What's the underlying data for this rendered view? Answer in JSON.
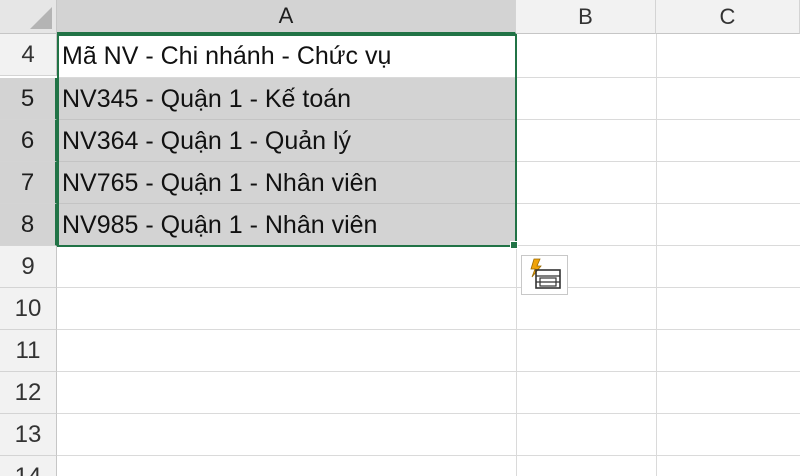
{
  "columns": [
    "A",
    "B",
    "C"
  ],
  "rows": [
    "4",
    "5",
    "6",
    "7",
    "8",
    "9",
    "10",
    "11",
    "12",
    "13",
    "14"
  ],
  "cells": {
    "a4": "Mã NV - Chi nhánh - Chức vụ",
    "a5": "NV345 - Quận 1 - Kế toán",
    "a6": "NV364 - Quận 1 - Quản lý",
    "a7": "NV765 - Quận 1 - Nhân viên",
    "a8": "NV985 - Quận 1 - Nhân viên"
  },
  "colors": {
    "selection_border": "#217346",
    "flash_fill_icon": "#f0a30a"
  },
  "icons": {
    "flash_fill_options": "flash-fill-options-icon",
    "select_all": "select-all-icon"
  }
}
